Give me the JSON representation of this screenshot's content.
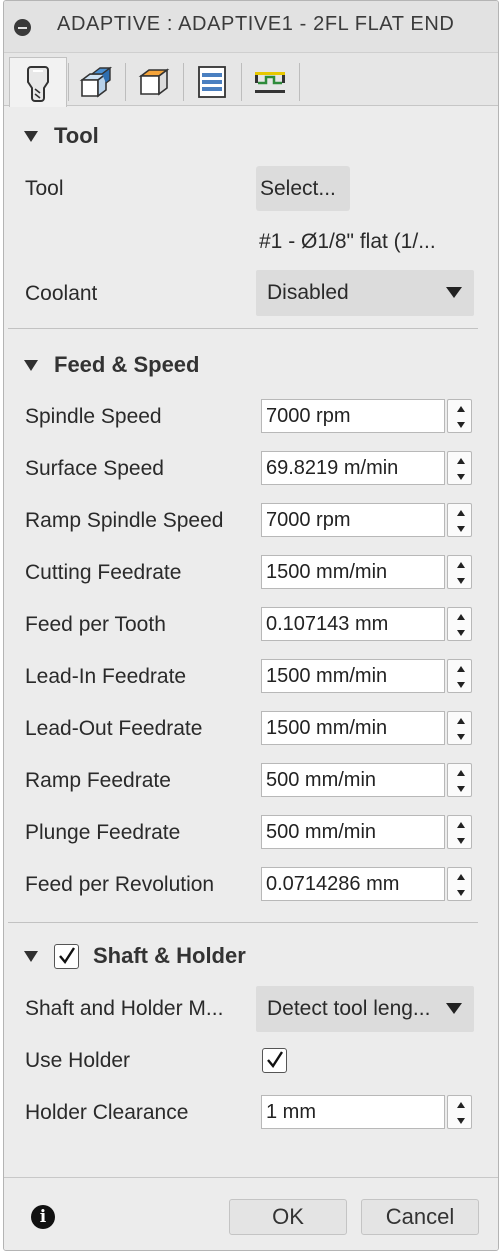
{
  "window": {
    "title": "ADAPTIVE : ADAPTIVE1 - 2FL FLAT END"
  },
  "tabs": [
    {
      "icon": "tool-icon",
      "active": true
    },
    {
      "icon": "geometry-icon",
      "active": false
    },
    {
      "icon": "heights-icon",
      "active": false
    },
    {
      "icon": "passes-icon",
      "active": false
    },
    {
      "icon": "linking-icon",
      "active": false
    }
  ],
  "tool_section": {
    "header": "Tool",
    "tool_label": "Tool",
    "select_button": "Select...",
    "tool_name": "#1 - Ø1/8\" flat (1/...",
    "coolant_label": "Coolant",
    "coolant_value": "Disabled"
  },
  "feed_section": {
    "header": "Feed & Speed",
    "fields": [
      {
        "label": "Spindle Speed",
        "value": "7000 rpm"
      },
      {
        "label": "Surface Speed",
        "value": "69.8219 m/min"
      },
      {
        "label": "Ramp Spindle Speed",
        "value": "7000 rpm"
      },
      {
        "label": "Cutting Feedrate",
        "value": "1500 mm/min"
      },
      {
        "label": "Feed per Tooth",
        "value": "0.107143 mm"
      },
      {
        "label": "Lead-In Feedrate",
        "value": "1500 mm/min"
      },
      {
        "label": "Lead-Out Feedrate",
        "value": "1500 mm/min"
      },
      {
        "label": "Ramp Feedrate",
        "value": "500 mm/min"
      },
      {
        "label": "Plunge Feedrate",
        "value": "500 mm/min"
      },
      {
        "label": "Feed per Revolution",
        "value": "0.0714286 mm"
      }
    ]
  },
  "shaft_section": {
    "header": "Shaft & Holder",
    "enabled": true,
    "mode_label": "Shaft and Holder M...",
    "mode_value": "Detect tool leng...",
    "use_holder_label": "Use Holder",
    "use_holder": true,
    "clearance_label": "Holder Clearance",
    "clearance_value": "1 mm"
  },
  "footer": {
    "ok_label": "OK",
    "cancel_label": "Cancel",
    "info_icon": "info-icon"
  }
}
